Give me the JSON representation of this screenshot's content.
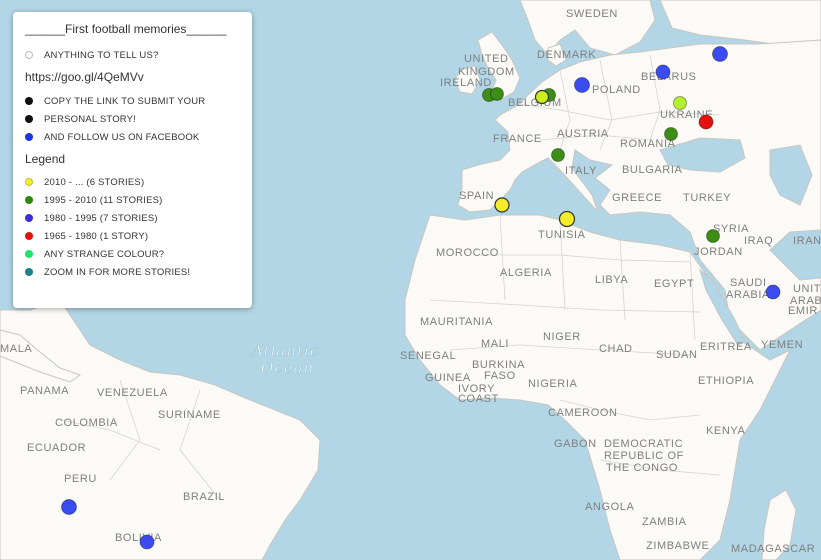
{
  "legend": {
    "title": "______First football memories______",
    "tell_us": "ANYTHING TO TELL US?",
    "link": "https://goo.gl/4QeMVv",
    "instructions": [
      "COPY THE LINK TO SUBMIT YOUR",
      "PERSONAL STORY!",
      "AND FOLLOW US ON FACEBOOK"
    ],
    "heading": "Legend",
    "categories": [
      {
        "label": "2010 - ... (6 STORIES)",
        "color": "#f5ec2a"
      },
      {
        "label": "1995 - 2010 (11 STORIES)",
        "color": "#2a8a0e"
      },
      {
        "label": "1980 - 1995 (7 STORIES)",
        "color": "#3a2fd8"
      },
      {
        "label": "1965 - 1980 (1 STORY)",
        "color": "#e8100f"
      },
      {
        "label": "ANY STRANGE COLOUR?",
        "color": "#22e36e"
      },
      {
        "label": "ZOOM IN FOR MORE STORIES!",
        "color": "#1f7f8f"
      }
    ],
    "instruction_colors": [
      "#111111",
      "#111111",
      "#1a35e8"
    ]
  },
  "map": {
    "ocean_label": [
      "Atlantic",
      "Ocean"
    ],
    "labels": [
      "SWEDEN",
      "IRELAND",
      "UNITED",
      "KINGDOM",
      "DENMARK",
      "BELARUS",
      "POLAND",
      "BELGIUM",
      "FRANCE",
      "AUSTRIA",
      "UKRAINE",
      "ROMANIA",
      "ITALY",
      "BULGARIA",
      "SPAIN",
      "GREECE",
      "TURKEY",
      "TUNISIA",
      "SYRIA",
      "IRAQ",
      "IRAN",
      "MOROCCO",
      "ALGERIA",
      "LIBYA",
      "EGYPT",
      "JORDAN",
      "SAUDI",
      "ARABIA",
      "UNIT",
      "ARAB",
      "EMIR",
      "MAURITANIA",
      "MALI",
      "NIGER",
      "SENEGAL",
      "BURKINA",
      "FASO",
      "CHAD",
      "SUDAN",
      "ERITREA",
      "YEMEN",
      "GUINEA",
      "IVORY",
      "COAST",
      "NIGERIA",
      "ETHIOPIA",
      "CAMEROON",
      "GABON",
      "KENYA",
      "DEMOCRATIC",
      "REPUBLIC OF",
      "THE CONGO",
      "PANAMA",
      "VENEZUELA",
      "SURINAME",
      "COLOMBIA",
      "ECUADOR",
      "PERU",
      "BRAZIL",
      "BOLIVIA",
      "ANGOLA",
      "ZAMBIA",
      "ZIMBABWE",
      "MADAGASCAR",
      "MALA"
    ],
    "colors": {
      "water": "#b2d6e6",
      "land": "#fbfaf7",
      "border": "#c9c6c0"
    }
  }
}
